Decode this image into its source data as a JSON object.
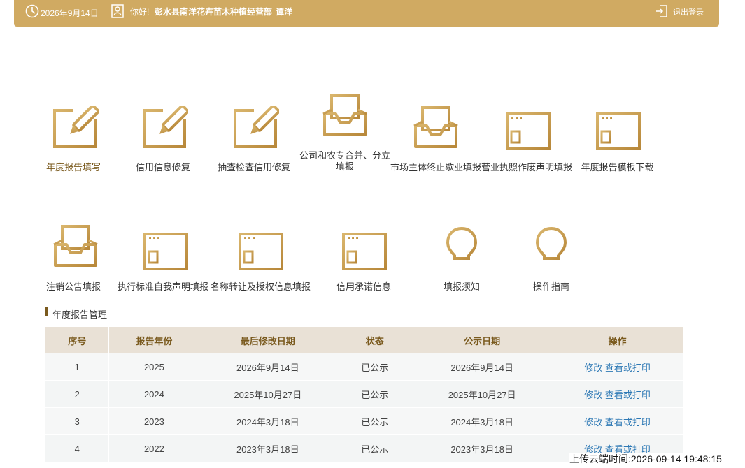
{
  "header": {
    "date": "2026年9月14日",
    "greeting": "你好!",
    "company": "彭水县南洋花卉苗木种植经营部",
    "person": "谭洋",
    "logout": "退出登录"
  },
  "colors": {
    "brand": "#d0aa62",
    "accent": "#b8883a",
    "link": "#2e79b5"
  },
  "tiles_row1": [
    {
      "label": "年度报告填写",
      "icon": "edit-pencil-icon"
    },
    {
      "label": "信用信息修复",
      "icon": "edit-pencil-icon"
    },
    {
      "label": "抽查检查信用修复",
      "icon": "edit-pencil-icon"
    },
    {
      "label": "公司和农专合并、分立填报",
      "icon": "inbox-tray-icon"
    },
    {
      "label": "市场主体终止歇业填报",
      "icon": "inbox-tray-icon"
    },
    {
      "label": "营业执照作废声明填报",
      "icon": "document-window-icon"
    },
    {
      "label": "年度报告模板下载",
      "icon": "document-window-icon"
    }
  ],
  "tiles_row2": [
    {
      "label": "注销公告填报",
      "icon": "inbox-tray-icon"
    },
    {
      "label": "执行标准自我声明填报",
      "icon": "document-window-icon"
    },
    {
      "label": "名称转让及授权信息填报",
      "icon": "document-window-icon"
    },
    {
      "label": "信用承诺信息",
      "icon": "document-window-icon"
    },
    {
      "label": "填报须知",
      "icon": "lightbulb-icon"
    },
    {
      "label": "操作指南",
      "icon": "lightbulb-icon"
    }
  ],
  "section": {
    "title": "年度报告管理"
  },
  "table": {
    "headers": [
      "序号",
      "报告年份",
      "最后修改日期",
      "状态",
      "公示日期",
      "操作"
    ],
    "rows": [
      {
        "no": "1",
        "year": "2025",
        "modified": "2026年9月14日",
        "status": "已公示",
        "published": "2026年9月14日",
        "edit": "修改",
        "view": "查看或打印"
      },
      {
        "no": "2",
        "year": "2024",
        "modified": "2025年10月27日",
        "status": "已公示",
        "published": "2025年10月27日",
        "edit": "修改",
        "view": "查看或打印"
      },
      {
        "no": "3",
        "year": "2023",
        "modified": "2024年3月18日",
        "status": "已公示",
        "published": "2024年3月18日",
        "edit": "修改",
        "view": "查看或打印"
      },
      {
        "no": "4",
        "year": "2022",
        "modified": "2023年3月18日",
        "status": "已公示",
        "published": "2023年3月18日",
        "edit": "修改",
        "view": "查看或打印"
      }
    ]
  },
  "upload_time": "上传云端时间:2026-09-14 19:48:15"
}
